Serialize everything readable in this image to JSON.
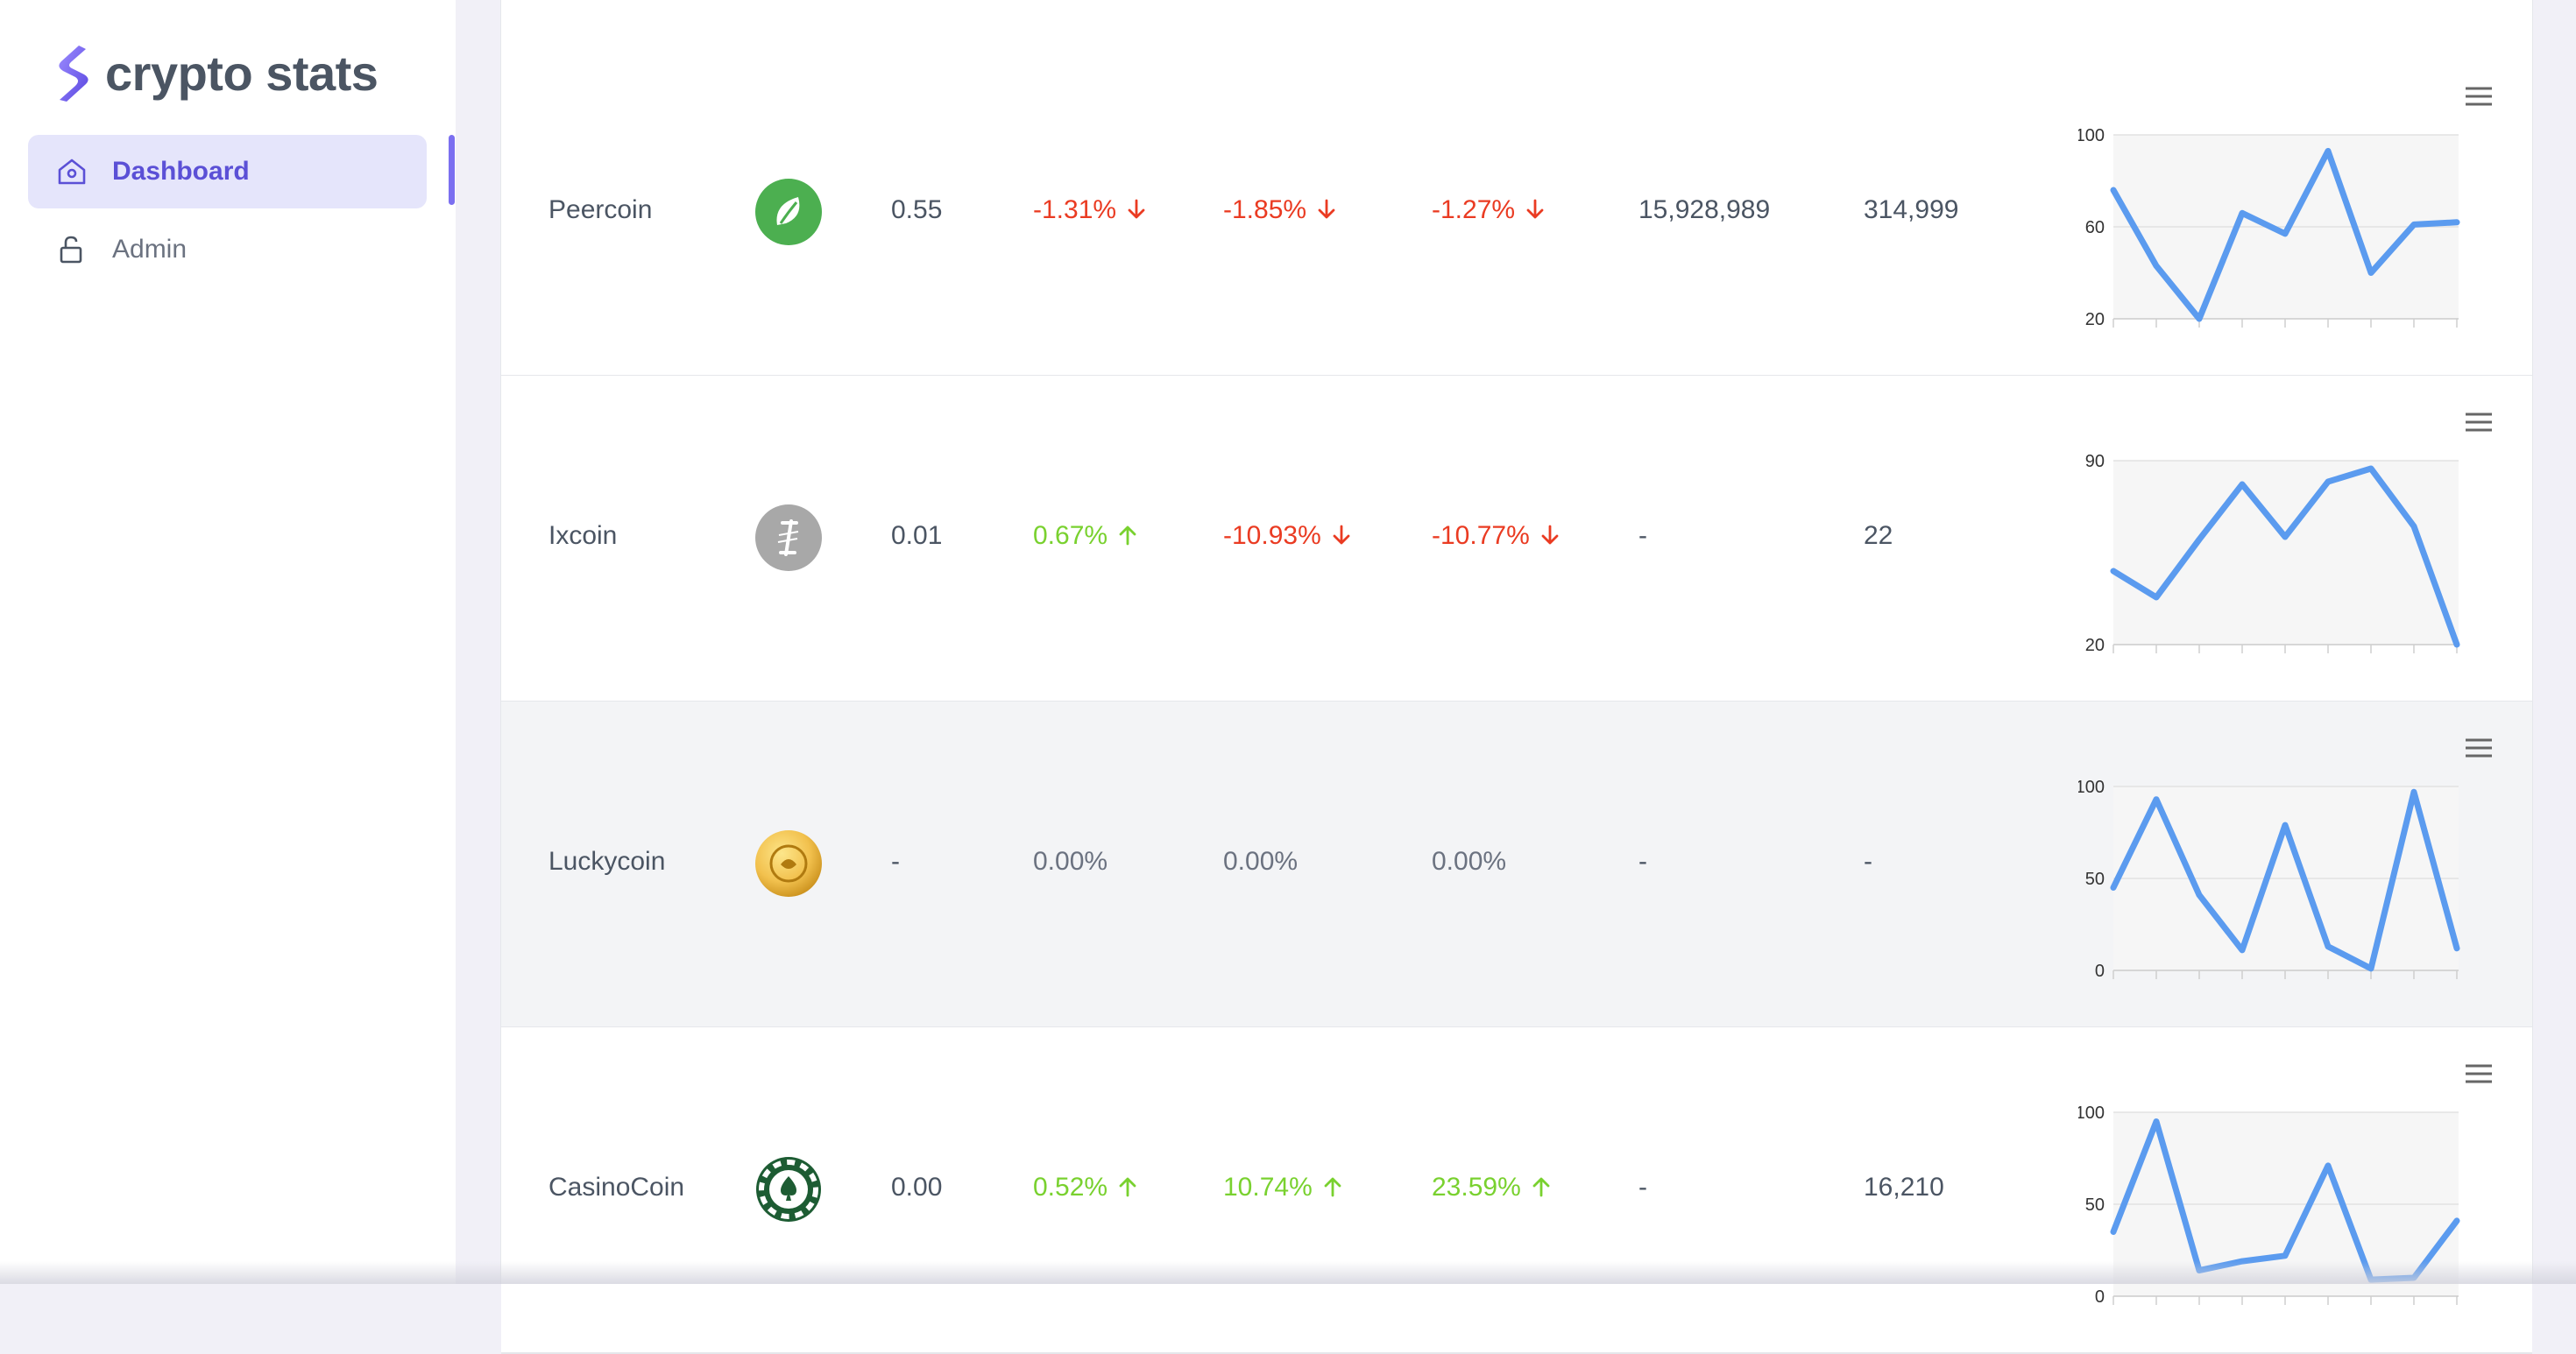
{
  "app": {
    "logo_text": "crypto stats",
    "brand_color": "#7b6ff0"
  },
  "sidebar": {
    "items": [
      {
        "label": "Dashboard",
        "icon": "home-icon",
        "active": true
      },
      {
        "label": "Admin",
        "icon": "lock-open-icon",
        "active": false
      }
    ]
  },
  "table": {
    "rows": [
      {
        "name": "Peercoin",
        "icon": "peercoin-leaf-icon",
        "price": "0.55",
        "change_1h": "-1.31%",
        "change_1h_dir": "down",
        "change_24h": "-1.85%",
        "change_24h_dir": "down",
        "change_7d": "-1.27%",
        "change_7d_dir": "down",
        "volume": "15,928,989",
        "market_cap": "314,999",
        "sparkline": {
          "ticks": [
            "100",
            "60",
            "20"
          ],
          "ymin": 20,
          "ymax": 100,
          "values": [
            76,
            43,
            20,
            66,
            57,
            93,
            40,
            61,
            62
          ]
        }
      },
      {
        "name": "Ixcoin",
        "icon": "ixcoin-icon",
        "price": "0.01",
        "change_1h": "0.67%",
        "change_1h_dir": "up",
        "change_24h": "-10.93%",
        "change_24h_dir": "down",
        "change_7d": "-10.77%",
        "change_7d_dir": "down",
        "volume": "-",
        "market_cap": "22",
        "sparkline": {
          "ticks": [
            "90",
            "20"
          ],
          "ymin": 20,
          "ymax": 90,
          "values": [
            48,
            38,
            60,
            81,
            61,
            82,
            87,
            65,
            20
          ]
        }
      },
      {
        "name": "Luckycoin",
        "icon": "luckycoin-icon",
        "price": "-",
        "change_1h": "0.00%",
        "change_1h_dir": "none",
        "change_24h": "0.00%",
        "change_24h_dir": "none",
        "change_7d": "0.00%",
        "change_7d_dir": "none",
        "volume": "-",
        "market_cap": "-",
        "sparkline": {
          "ticks": [
            "100",
            "50",
            "0"
          ],
          "ymin": 0,
          "ymax": 100,
          "values": [
            45,
            93,
            41,
            11,
            79,
            13,
            1,
            97,
            12
          ]
        }
      },
      {
        "name": "CasinoCoin",
        "icon": "casinocoin-chip-icon",
        "price": "0.00",
        "change_1h": "0.52%",
        "change_1h_dir": "up",
        "change_24h": "10.74%",
        "change_24h_dir": "up",
        "change_7d": "23.59%",
        "change_7d_dir": "up",
        "volume": "-",
        "market_cap": "16,210",
        "sparkline": {
          "ticks": [
            "100",
            "50",
            "0"
          ],
          "ymin": 0,
          "ymax": 100,
          "values": [
            35,
            95,
            14,
            19,
            22,
            71,
            9,
            10,
            41
          ]
        }
      }
    ]
  }
}
